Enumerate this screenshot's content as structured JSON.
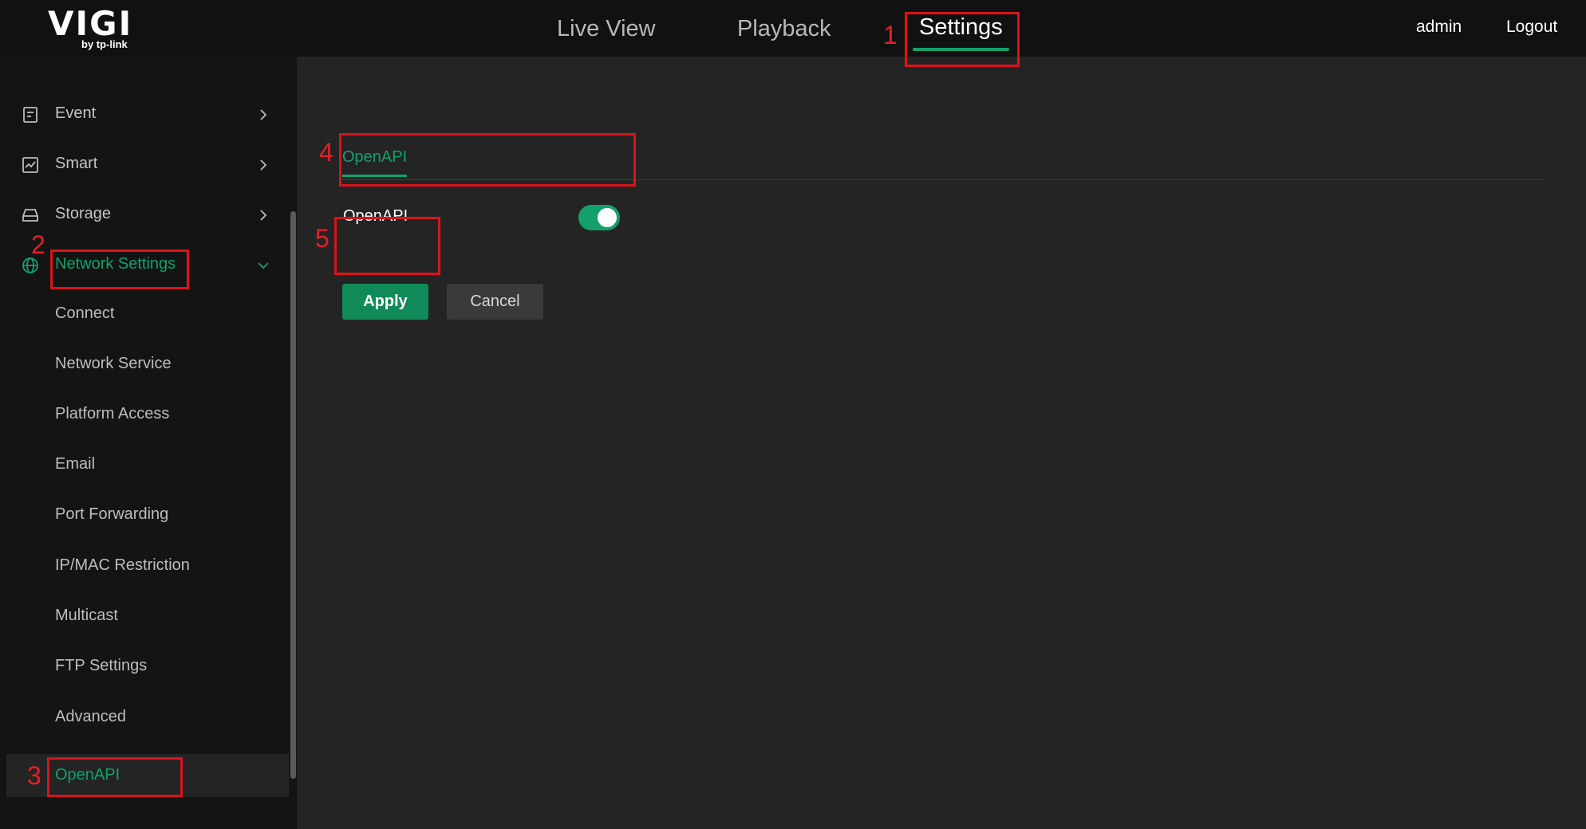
{
  "brand": {
    "name": "VIGI",
    "tagline": "by tp-link"
  },
  "topnav": {
    "tabs": [
      {
        "label": "Live View",
        "active": false
      },
      {
        "label": "Playback",
        "active": false
      },
      {
        "label": "Settings",
        "active": true
      }
    ],
    "user": "admin",
    "logout": "Logout"
  },
  "sidebar": {
    "items": [
      {
        "label": "Event",
        "icon": "event-icon",
        "expanded": false
      },
      {
        "label": "Smart",
        "icon": "chart-icon",
        "expanded": false
      },
      {
        "label": "Storage",
        "icon": "storage-icon",
        "expanded": false
      },
      {
        "label": "Network Settings",
        "icon": "globe-icon",
        "expanded": true
      }
    ],
    "network_subitems": [
      "Connect",
      "Network Service",
      "Platform Access",
      "Email",
      "Port Forwarding",
      "IP/MAC Restriction",
      "Multicast",
      "FTP Settings",
      "Advanced",
      "OpenAPI"
    ],
    "selected": "OpenAPI"
  },
  "content": {
    "tab": "OpenAPI",
    "field_label": "OpenAPI",
    "toggle_on": true,
    "apply": "Apply",
    "cancel": "Cancel"
  },
  "annotations": [
    "1",
    "2",
    "3",
    "4",
    "5"
  ],
  "colors": {
    "accent": "#14a06a",
    "annotation": "#d9141c",
    "topbar": "#111111",
    "content_bg": "#242424"
  }
}
